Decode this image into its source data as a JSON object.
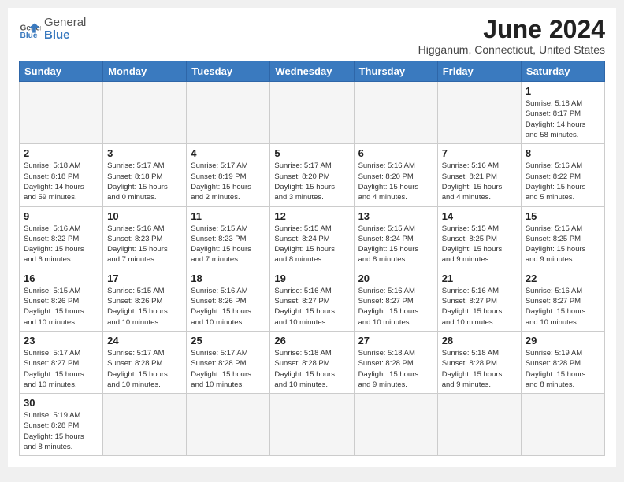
{
  "header": {
    "logo_general": "General",
    "logo_blue": "Blue",
    "month_title": "June 2024",
    "location": "Higganum, Connecticut, United States"
  },
  "weekdays": [
    "Sunday",
    "Monday",
    "Tuesday",
    "Wednesday",
    "Thursday",
    "Friday",
    "Saturday"
  ],
  "weeks": [
    [
      {
        "day": "",
        "info": ""
      },
      {
        "day": "",
        "info": ""
      },
      {
        "day": "",
        "info": ""
      },
      {
        "day": "",
        "info": ""
      },
      {
        "day": "",
        "info": ""
      },
      {
        "day": "",
        "info": ""
      },
      {
        "day": "1",
        "info": "Sunrise: 5:18 AM\nSunset: 8:17 PM\nDaylight: 14 hours\nand 58 minutes."
      }
    ],
    [
      {
        "day": "2",
        "info": "Sunrise: 5:18 AM\nSunset: 8:18 PM\nDaylight: 14 hours\nand 59 minutes."
      },
      {
        "day": "3",
        "info": "Sunrise: 5:17 AM\nSunset: 8:18 PM\nDaylight: 15 hours\nand 0 minutes."
      },
      {
        "day": "4",
        "info": "Sunrise: 5:17 AM\nSunset: 8:19 PM\nDaylight: 15 hours\nand 2 minutes."
      },
      {
        "day": "5",
        "info": "Sunrise: 5:17 AM\nSunset: 8:20 PM\nDaylight: 15 hours\nand 3 minutes."
      },
      {
        "day": "6",
        "info": "Sunrise: 5:16 AM\nSunset: 8:20 PM\nDaylight: 15 hours\nand 4 minutes."
      },
      {
        "day": "7",
        "info": "Sunrise: 5:16 AM\nSunset: 8:21 PM\nDaylight: 15 hours\nand 4 minutes."
      },
      {
        "day": "8",
        "info": "Sunrise: 5:16 AM\nSunset: 8:22 PM\nDaylight: 15 hours\nand 5 minutes."
      }
    ],
    [
      {
        "day": "9",
        "info": "Sunrise: 5:16 AM\nSunset: 8:22 PM\nDaylight: 15 hours\nand 6 minutes."
      },
      {
        "day": "10",
        "info": "Sunrise: 5:16 AM\nSunset: 8:23 PM\nDaylight: 15 hours\nand 7 minutes."
      },
      {
        "day": "11",
        "info": "Sunrise: 5:15 AM\nSunset: 8:23 PM\nDaylight: 15 hours\nand 7 minutes."
      },
      {
        "day": "12",
        "info": "Sunrise: 5:15 AM\nSunset: 8:24 PM\nDaylight: 15 hours\nand 8 minutes."
      },
      {
        "day": "13",
        "info": "Sunrise: 5:15 AM\nSunset: 8:24 PM\nDaylight: 15 hours\nand 8 minutes."
      },
      {
        "day": "14",
        "info": "Sunrise: 5:15 AM\nSunset: 8:25 PM\nDaylight: 15 hours\nand 9 minutes."
      },
      {
        "day": "15",
        "info": "Sunrise: 5:15 AM\nSunset: 8:25 PM\nDaylight: 15 hours\nand 9 minutes."
      }
    ],
    [
      {
        "day": "16",
        "info": "Sunrise: 5:15 AM\nSunset: 8:26 PM\nDaylight: 15 hours\nand 10 minutes."
      },
      {
        "day": "17",
        "info": "Sunrise: 5:15 AM\nSunset: 8:26 PM\nDaylight: 15 hours\nand 10 minutes."
      },
      {
        "day": "18",
        "info": "Sunrise: 5:16 AM\nSunset: 8:26 PM\nDaylight: 15 hours\nand 10 minutes."
      },
      {
        "day": "19",
        "info": "Sunrise: 5:16 AM\nSunset: 8:27 PM\nDaylight: 15 hours\nand 10 minutes."
      },
      {
        "day": "20",
        "info": "Sunrise: 5:16 AM\nSunset: 8:27 PM\nDaylight: 15 hours\nand 10 minutes."
      },
      {
        "day": "21",
        "info": "Sunrise: 5:16 AM\nSunset: 8:27 PM\nDaylight: 15 hours\nand 10 minutes."
      },
      {
        "day": "22",
        "info": "Sunrise: 5:16 AM\nSunset: 8:27 PM\nDaylight: 15 hours\nand 10 minutes."
      }
    ],
    [
      {
        "day": "23",
        "info": "Sunrise: 5:17 AM\nSunset: 8:27 PM\nDaylight: 15 hours\nand 10 minutes."
      },
      {
        "day": "24",
        "info": "Sunrise: 5:17 AM\nSunset: 8:28 PM\nDaylight: 15 hours\nand 10 minutes."
      },
      {
        "day": "25",
        "info": "Sunrise: 5:17 AM\nSunset: 8:28 PM\nDaylight: 15 hours\nand 10 minutes."
      },
      {
        "day": "26",
        "info": "Sunrise: 5:18 AM\nSunset: 8:28 PM\nDaylight: 15 hours\nand 10 minutes."
      },
      {
        "day": "27",
        "info": "Sunrise: 5:18 AM\nSunset: 8:28 PM\nDaylight: 15 hours\nand 9 minutes."
      },
      {
        "day": "28",
        "info": "Sunrise: 5:18 AM\nSunset: 8:28 PM\nDaylight: 15 hours\nand 9 minutes."
      },
      {
        "day": "29",
        "info": "Sunrise: 5:19 AM\nSunset: 8:28 PM\nDaylight: 15 hours\nand 8 minutes."
      }
    ],
    [
      {
        "day": "30",
        "info": "Sunrise: 5:19 AM\nSunset: 8:28 PM\nDaylight: 15 hours\nand 8 minutes."
      },
      {
        "day": "",
        "info": ""
      },
      {
        "day": "",
        "info": ""
      },
      {
        "day": "",
        "info": ""
      },
      {
        "day": "",
        "info": ""
      },
      {
        "day": "",
        "info": ""
      },
      {
        "day": "",
        "info": ""
      }
    ]
  ]
}
